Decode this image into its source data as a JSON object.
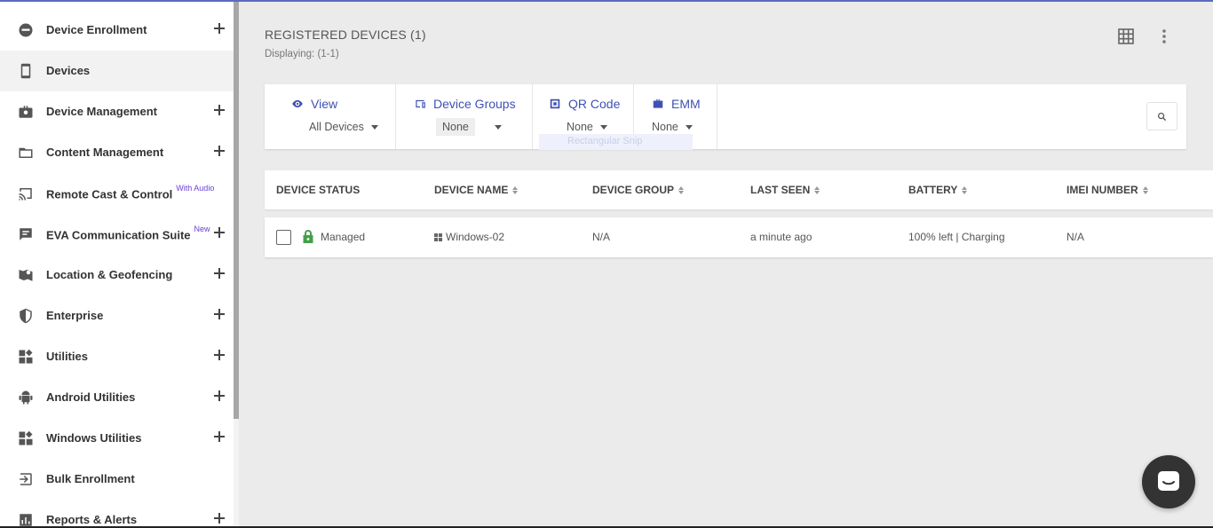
{
  "sidebar": {
    "items": [
      {
        "label": "Device Enrollment",
        "icon": "enrollment-icon",
        "expandable": true,
        "badge": ""
      },
      {
        "label": "Devices",
        "icon": "phone-icon",
        "expandable": false,
        "active": true,
        "badge": ""
      },
      {
        "label": "Device Management",
        "icon": "briefcase-icon",
        "expandable": true,
        "badge": ""
      },
      {
        "label": "Content Management",
        "icon": "folder-icon",
        "expandable": true,
        "badge": ""
      },
      {
        "label": "Remote Cast & Control",
        "icon": "cast-icon",
        "expandable": false,
        "badge": "With Audio"
      },
      {
        "label": "EVA Communication Suite",
        "icon": "chat-icon",
        "expandable": true,
        "badge": "New"
      },
      {
        "label": "Location & Geofencing",
        "icon": "map-pin-icon",
        "expandable": true,
        "badge": ""
      },
      {
        "label": "Enterprise",
        "icon": "shield-icon",
        "expandable": true,
        "badge": ""
      },
      {
        "label": "Utilities",
        "icon": "widgets-icon",
        "expandable": true,
        "badge": ""
      },
      {
        "label": "Android Utilities",
        "icon": "android-icon",
        "expandable": true,
        "badge": ""
      },
      {
        "label": "Windows Utilities",
        "icon": "widgets-icon",
        "expandable": true,
        "badge": ""
      },
      {
        "label": "Bulk Enrollment",
        "icon": "login-icon",
        "expandable": false,
        "badge": ""
      },
      {
        "label": "Reports & Alerts",
        "icon": "bar-chart-icon",
        "expandable": true,
        "badge": ""
      }
    ]
  },
  "header": {
    "title": "REGISTERED DEVICES (1)",
    "displaying": "Displaying: (1-1)"
  },
  "filters": {
    "view": {
      "label": "View",
      "value": "All Devices"
    },
    "device_groups": {
      "label": "Device Groups",
      "value": "None"
    },
    "qr_code": {
      "label": "QR Code",
      "value": "None"
    },
    "emm": {
      "label": "EMM",
      "value": "None"
    },
    "snip_overlay": "Rectangular Snip"
  },
  "table": {
    "columns": [
      "DEVICE STATUS",
      "DEVICE NAME",
      "DEVICE GROUP",
      "LAST SEEN",
      "BATTERY",
      "IMEI NUMBER"
    ],
    "rows": [
      {
        "status": "Managed",
        "name": "Windows-02",
        "group": "N/A",
        "last_seen": "a minute ago",
        "battery": "100% left | Charging",
        "imei": "N/A"
      }
    ]
  },
  "colors": {
    "accent": "#3f51b5",
    "managed_lock": "#43a047",
    "badge": "#6a3fd8"
  }
}
